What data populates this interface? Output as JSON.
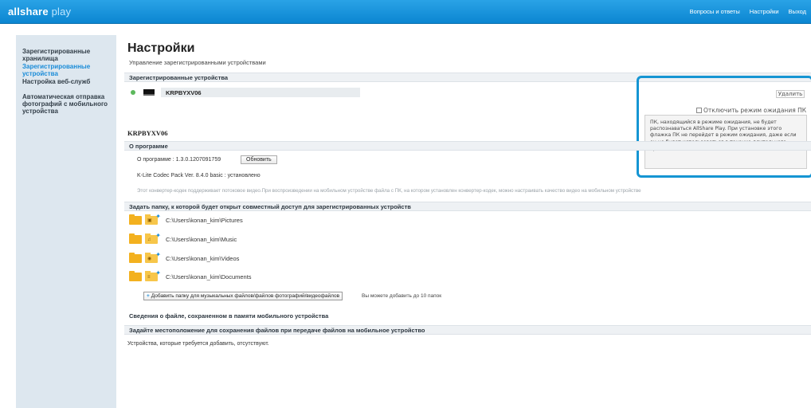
{
  "header": {
    "logo_main": "allshare",
    "logo_play": "play",
    "links": [
      "Вопросы и ответы",
      "Настройки",
      "Выход"
    ]
  },
  "sidebar": {
    "items": [
      {
        "label": "Зарегистрированные хранилища"
      },
      {
        "label": "Зарегистрированные устройства"
      },
      {
        "label": "Настройка веб-служб"
      },
      {
        "label": "Автоматическая отправка фотографий с мобильного устройства"
      }
    ]
  },
  "main": {
    "title": "Настройки",
    "subtitle": "Управление зарегистрированными устройствами",
    "registered_header": "Зарегистрированные устройства",
    "device_name": "KRPBYXV06",
    "delete_label": "Удалить",
    "standby_label": "Отключить режим ожидания ПК",
    "tooltip": "ПК, находящийся в режиме ожидания, не будет распознаваться AllShare Play. При установке этого флажка ПК не перейдет в режим ожидания, даже если он не будет использоваться в течение длительного времени",
    "device_title": "KRPBYXV06",
    "about_header": "О программе",
    "version_text": "О программе : 1.3.0.1207091759",
    "update_label": "Обновить",
    "codec_text": "K-Lite Codec Pack Ver. 8.4.0 basic : установлено",
    "codec_note": "Этот конвертер-кодек поддерживает потоковое видео.При воспроизведении на мобильном устройстве файла с ПК, на котором установлен конвертер-кодек, можно настраивать качество видео на мобильном устройстве",
    "folders_header": "Задать папку, к которой будет открыт совместный доступ для зарегистрированных устройств",
    "folders": [
      {
        "path": "C:\\Users\\konan_kim\\Pictures",
        "icon": "pictures-folder-icon"
      },
      {
        "path": "C:\\Users\\konan_kim\\Music",
        "icon": "music-folder-icon"
      },
      {
        "path": "C:\\Users\\konan_kim\\Videos",
        "icon": "videos-folder-icon"
      },
      {
        "path": "C:\\Users\\konan_kim\\Documents",
        "icon": "documents-folder-icon"
      }
    ],
    "add_folder_label": "Добавить папку для музыкальных файлов/файлов фотографий/видеофайлов",
    "add_folder_note": "Вы можете добавить до 10 папок",
    "mobile_info": "Сведения о файле, сохраненном в памяти мобильного устройства",
    "save_location_header": "Задайте местоположение для сохранения файлов при передаче файлов на мобильное устройство",
    "no_devices": "Устройства, которые требуется добавить, отсутствуют."
  }
}
